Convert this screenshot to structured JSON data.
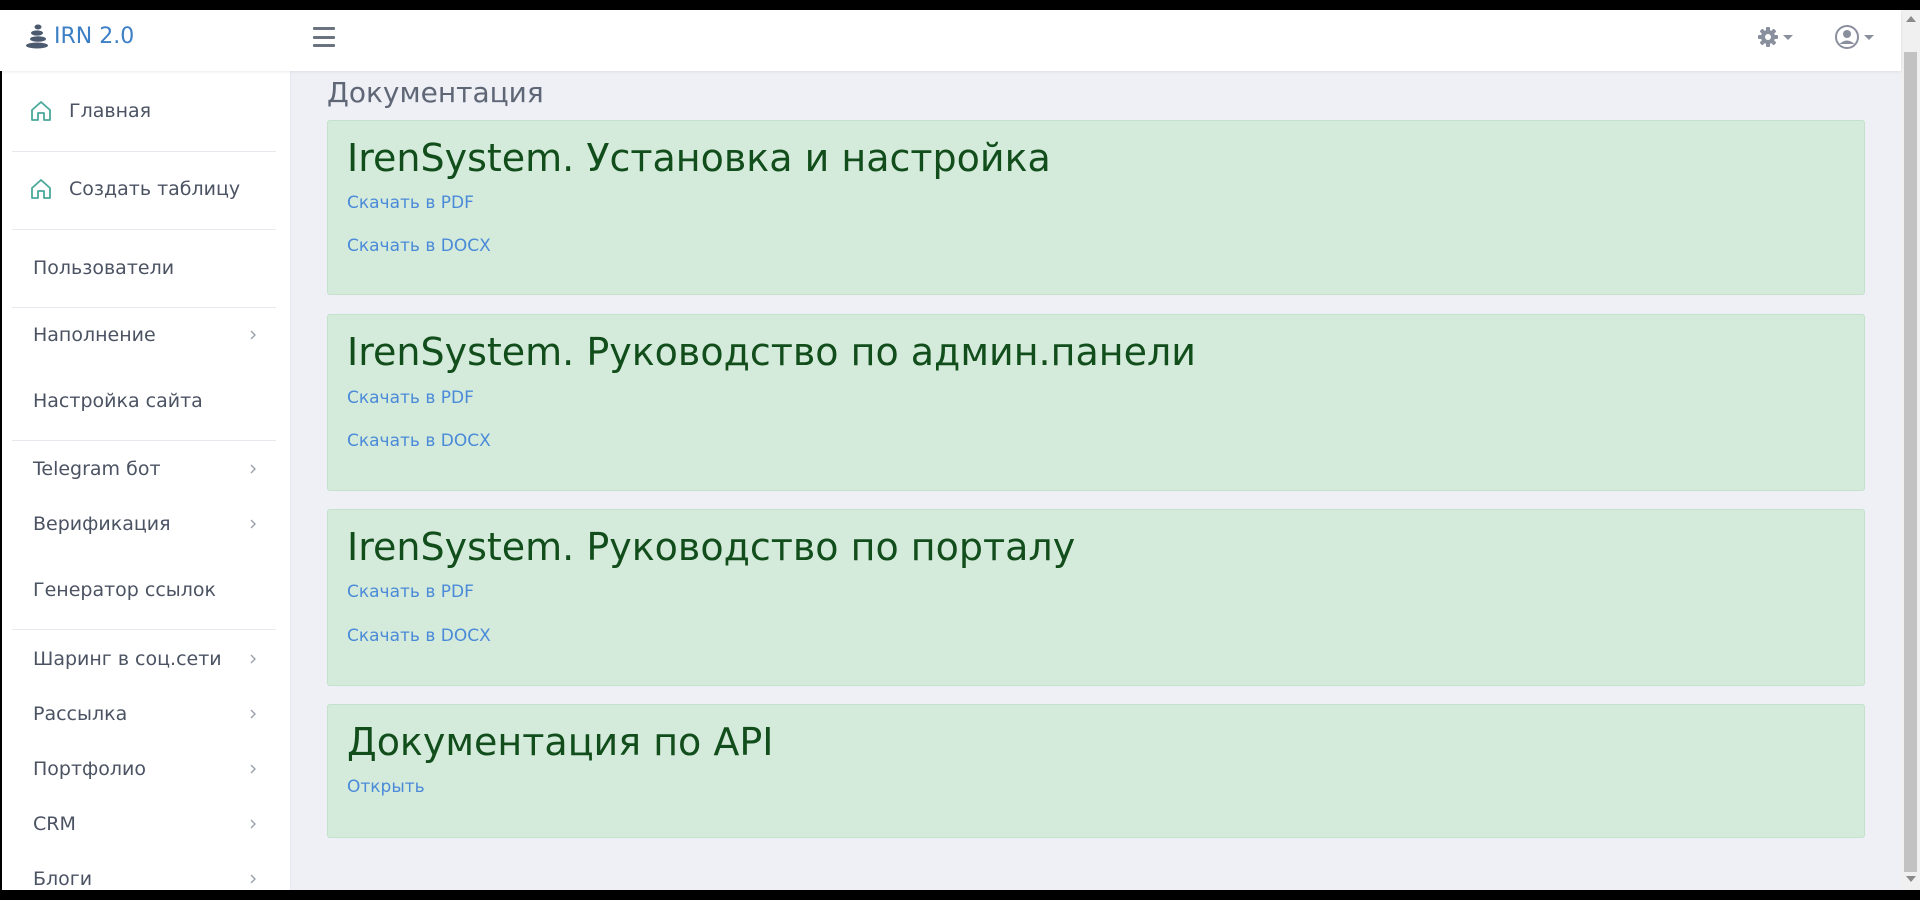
{
  "header": {
    "brand_text": "IRN 2.0",
    "brand_color": "#3c7fc4",
    "icons": [
      "menu-icon",
      "gear-icon",
      "user-circle-icon"
    ]
  },
  "sidebar": {
    "items": [
      {
        "label": "Главная",
        "icon": "home-icon",
        "has_submenu": false
      },
      {
        "label": "Создать таблицу",
        "icon": "home-icon",
        "has_submenu": false
      },
      {
        "label": "Пользователи",
        "has_submenu": false
      },
      {
        "label": "Наполнение",
        "has_submenu": true
      },
      {
        "label": "Настройка сайта",
        "has_submenu": false
      },
      {
        "label": "Telegram бот",
        "has_submenu": true
      },
      {
        "label": "Верификация",
        "has_submenu": true
      },
      {
        "label": "Генератор ссылок",
        "has_submenu": false
      },
      {
        "label": "Шаринг в соц.сети",
        "has_submenu": true
      },
      {
        "label": "Рассылка",
        "has_submenu": true
      },
      {
        "label": "Портфолио",
        "has_submenu": true
      },
      {
        "label": "CRM",
        "has_submenu": true
      },
      {
        "label": "Блоги",
        "has_submenu": true
      }
    ]
  },
  "main": {
    "page_title": "Документация",
    "cards": [
      {
        "title": "IrenSystem. Установка и настройка",
        "links": [
          "Скачать в PDF",
          "Скачать в DOCX"
        ]
      },
      {
        "title": "IrenSystem. Руководство по админ.панели",
        "links": [
          "Скачать в PDF",
          "Скачать в DOCX"
        ]
      },
      {
        "title": "IrenSystem. Руководство по порталу",
        "links": [
          "Скачать в PDF",
          "Скачать в DOCX"
        ]
      },
      {
        "title": "Документация по API",
        "links": [
          "Открыть"
        ]
      }
    ],
    "card_bg": "#d4ebdb",
    "title_color": "#124d1c",
    "link_color": "#4a8ad8"
  }
}
